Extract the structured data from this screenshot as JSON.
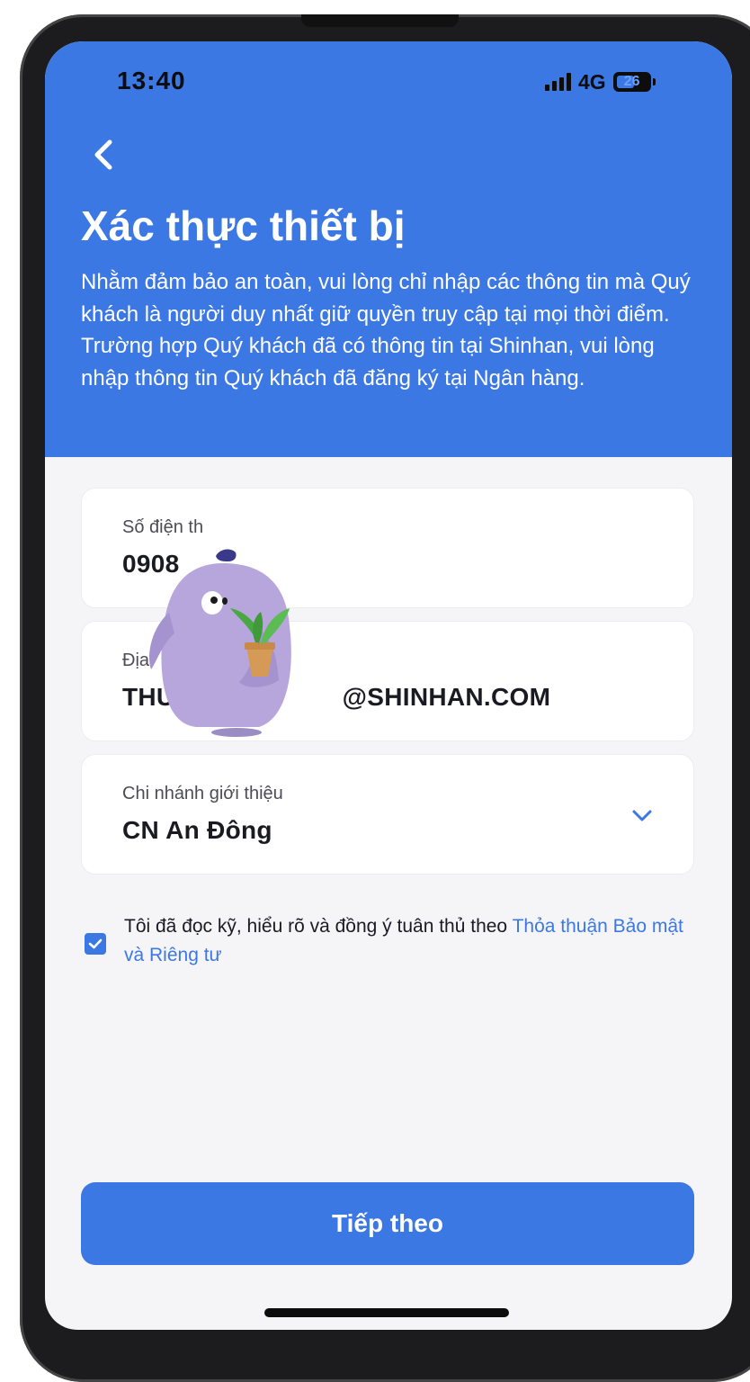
{
  "status_bar": {
    "time": "13:40",
    "network": "4G",
    "battery": "26"
  },
  "header": {
    "title": "Xác thực thiết bị",
    "description": "Nhằm đảm bảo an toàn, vui lòng chỉ nhập các thông tin mà Quý khách là người duy nhất giữ quyền truy cập tại mọi thời điểm. Trường hợp Quý khách đã có thông tin tại Shinhan, vui lòng nhập thông tin Quý khách đã đăng ký tại Ngân hàng."
  },
  "form": {
    "phone": {
      "label": "Số điện th",
      "value": "0908"
    },
    "email": {
      "label": "Địa",
      "value_prefix": "THU",
      "value_suffix": "@SHINHAN.COM"
    },
    "branch": {
      "label": "Chi nhánh giới thiệu",
      "value": "CN An Đông"
    }
  },
  "agreement": {
    "checked": true,
    "text": "Tôi đã đọc kỹ, hiểu rõ và đồng ý tuân thủ theo ",
    "link": "Thỏa thuận Bảo mật và Riêng tư"
  },
  "button": {
    "label": "Tiếp theo"
  },
  "icons": {
    "back": "back-chevron-icon",
    "dropdown": "chevron-down-icon",
    "check": "check-icon",
    "signal": "signal-icon",
    "battery": "battery-icon"
  },
  "colors": {
    "primary": "#3c78e3",
    "background": "#f5f5f8",
    "mascot": "#b7a6dc"
  }
}
